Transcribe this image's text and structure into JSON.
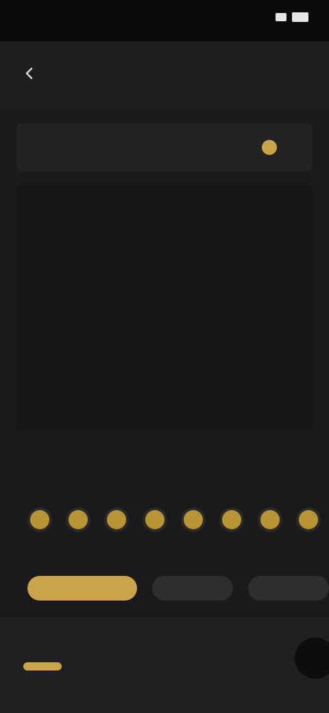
{
  "status_bar": {
    "time": ""
  },
  "app_bar": {
    "title": ""
  },
  "header_card": {
    "left_label": "",
    "right_label": ""
  },
  "canvas": {
    "big_value": "",
    "footer_text": ""
  },
  "section": {
    "title": "",
    "link": ""
  },
  "dot_picker": {
    "label": "",
    "count": 8
  },
  "chips": {
    "label": "",
    "items": [
      "",
      "",
      ""
    ],
    "selected_index": 0
  },
  "bottom_bar": {
    "title": "",
    "subtitle": ""
  },
  "colors": {
    "accent": "#c9a44a",
    "background": "#121212",
    "surface": "#1f1f1f"
  }
}
